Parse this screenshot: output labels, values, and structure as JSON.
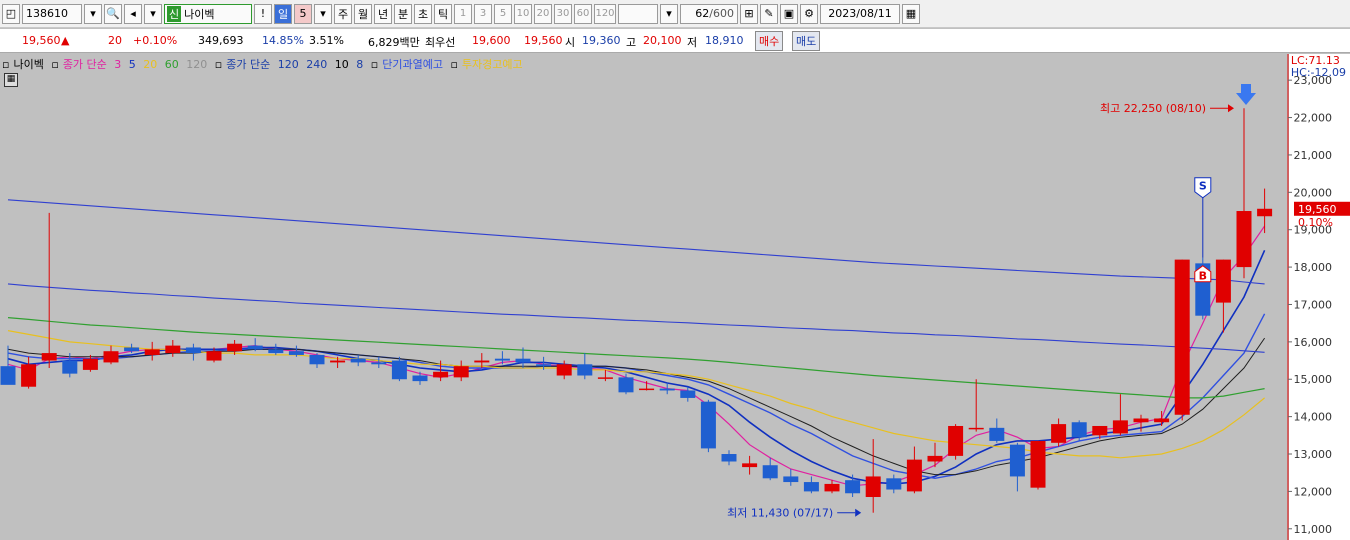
{
  "toolbar": {
    "code": "138610",
    "name_tag": "신",
    "name": "나이벡",
    "exclaim": "!",
    "period_day": "일",
    "period_value": "5",
    "week": "주",
    "month": "월",
    "year": "년",
    "minute": "분",
    "second": "초",
    "tick": "틱",
    "intervals": [
      "1",
      "3",
      "5",
      "10",
      "20",
      "30",
      "60",
      "120"
    ],
    "count": "62",
    "count_max": "/600",
    "date": "2023/08/11"
  },
  "quote": {
    "price": "19,560",
    "arrow": "▲",
    "change": "20",
    "change_pct": "+0.10%",
    "volume": "349,693",
    "turnover_pct": "14.85%",
    "pct2": "3.51%",
    "amount": "6,829백만",
    "best_ask_label": "최우선",
    "best_ask": "19,600",
    "best_bid": "19,560",
    "open_label": "시",
    "open": "19,360",
    "high_label": "고",
    "high": "20,100",
    "low_label": "저",
    "low": "18,910",
    "buy_btn": "매수",
    "sell_btn": "매도"
  },
  "legend": {
    "name": "나이벡",
    "ma_short_label": "종가 단순",
    "ma_3": "3",
    "ma_5": "5",
    "ma_20": "20",
    "ma_60": "60",
    "ma_120_dim": "120",
    "ma_long_label": "종가 단순",
    "ma_120": "120",
    "ma_240": "240",
    "ma_10": "10",
    "ma_8": "8",
    "warn1": "단기과열예고",
    "warn2": "투자경고예고"
  },
  "corner": {
    "lc": "LC:71.13",
    "hc": "HC:-12.09"
  },
  "colors": {
    "up": "#e00000",
    "down": "#1f5fd0",
    "ma3": "#e020a0",
    "ma5": "#1030c0",
    "ma10": "#3050e0",
    "ma8": "#202020",
    "ma20": "#e8c020",
    "ma60": "#30a030",
    "ma120": "#3040d0",
    "ma240": "#3040d0"
  },
  "chart_data": {
    "type": "candlestick",
    "ylim": [
      10700,
      23700
    ],
    "y_ticks": [
      "23,000",
      "22,000",
      "21,000",
      "20,000",
      "19,000",
      "18,000",
      "17,000",
      "16,000",
      "15,000",
      "14,000",
      "13,000",
      "12,000",
      "11,000"
    ],
    "y_tick_values": [
      23000,
      22000,
      21000,
      20000,
      19000,
      18000,
      17000,
      16000,
      15000,
      14000,
      13000,
      12000,
      11000
    ],
    "last_price_label": "19,560",
    "last_pct_label": "0.10%",
    "last_price": 19560,
    "high_annotation": "최고 22,250 (08/10)",
    "low_annotation": "최저 11,430 (07/17)",
    "high_value": 22250,
    "low_value": 11430,
    "high_index": 60,
    "low_index": 42,
    "signal_s_label": "S",
    "signal_s_index": 58,
    "signal_b_label": "B",
    "signal_b_index": 58,
    "candles": [
      {
        "o": 15350,
        "h": 15900,
        "l": 14900,
        "c": 14850
      },
      {
        "o": 14800,
        "h": 15600,
        "l": 14750,
        "c": 15400
      },
      {
        "o": 15500,
        "h": 19450,
        "l": 15300,
        "c": 15700
      },
      {
        "o": 15500,
        "h": 15700,
        "l": 15050,
        "c": 15150
      },
      {
        "o": 15250,
        "h": 15650,
        "l": 15200,
        "c": 15550
      },
      {
        "o": 15450,
        "h": 15900,
        "l": 15400,
        "c": 15750
      },
      {
        "o": 15850,
        "h": 15950,
        "l": 15700,
        "c": 15750
      },
      {
        "o": 15650,
        "h": 16000,
        "l": 15500,
        "c": 15800
      },
      {
        "o": 15700,
        "h": 16050,
        "l": 15600,
        "c": 15900
      },
      {
        "o": 15850,
        "h": 15950,
        "l": 15500,
        "c": 15700
      },
      {
        "o": 15500,
        "h": 15850,
        "l": 15450,
        "c": 15750
      },
      {
        "o": 15750,
        "h": 16050,
        "l": 15650,
        "c": 15950
      },
      {
        "o": 15900,
        "h": 16100,
        "l": 15750,
        "c": 15800
      },
      {
        "o": 15800,
        "h": 15950,
        "l": 15650,
        "c": 15700
      },
      {
        "o": 15750,
        "h": 15900,
        "l": 15600,
        "c": 15650
      },
      {
        "o": 15650,
        "h": 15700,
        "l": 15300,
        "c": 15400
      },
      {
        "o": 15450,
        "h": 15600,
        "l": 15300,
        "c": 15500
      },
      {
        "o": 15550,
        "h": 15650,
        "l": 15350,
        "c": 15450
      },
      {
        "o": 15450,
        "h": 15600,
        "l": 15300,
        "c": 15400
      },
      {
        "o": 15500,
        "h": 15600,
        "l": 14950,
        "c": 15000
      },
      {
        "o": 15100,
        "h": 15200,
        "l": 14850,
        "c": 14950
      },
      {
        "o": 15050,
        "h": 15500,
        "l": 14950,
        "c": 15200
      },
      {
        "o": 15050,
        "h": 15500,
        "l": 14950,
        "c": 15350
      },
      {
        "o": 15450,
        "h": 15700,
        "l": 15300,
        "c": 15500
      },
      {
        "o": 15550,
        "h": 15750,
        "l": 15400,
        "c": 15500
      },
      {
        "o": 15550,
        "h": 15850,
        "l": 15300,
        "c": 15450
      },
      {
        "o": 15400,
        "h": 15600,
        "l": 15250,
        "c": 15350
      },
      {
        "o": 15100,
        "h": 15500,
        "l": 15000,
        "c": 15400
      },
      {
        "o": 15400,
        "h": 15700,
        "l": 15000,
        "c": 15100
      },
      {
        "o": 15050,
        "h": 15250,
        "l": 14950,
        "c": 15050
      },
      {
        "o": 15050,
        "h": 15150,
        "l": 14600,
        "c": 14650
      },
      {
        "o": 14750,
        "h": 14950,
        "l": 14700,
        "c": 14750
      },
      {
        "o": 14750,
        "h": 14900,
        "l": 14600,
        "c": 14700
      },
      {
        "o": 14700,
        "h": 14800,
        "l": 14400,
        "c": 14500
      },
      {
        "o": 14400,
        "h": 14450,
        "l": 13050,
        "c": 13150
      },
      {
        "o": 13000,
        "h": 13100,
        "l": 12700,
        "c": 12800
      },
      {
        "o": 12650,
        "h": 12950,
        "l": 12450,
        "c": 12750
      },
      {
        "o": 12700,
        "h": 12900,
        "l": 12300,
        "c": 12350
      },
      {
        "o": 12400,
        "h": 12600,
        "l": 12150,
        "c": 12250
      },
      {
        "o": 12250,
        "h": 12400,
        "l": 11950,
        "c": 12000
      },
      {
        "o": 12000,
        "h": 12300,
        "l": 11950,
        "c": 12200
      },
      {
        "o": 12300,
        "h": 12450,
        "l": 11850,
        "c": 11950
      },
      {
        "o": 11850,
        "h": 13400,
        "l": 11430,
        "c": 12400
      },
      {
        "o": 12350,
        "h": 12450,
        "l": 11950,
        "c": 12050
      },
      {
        "o": 12000,
        "h": 13200,
        "l": 11950,
        "c": 12850
      },
      {
        "o": 12800,
        "h": 13300,
        "l": 12650,
        "c": 12950
      },
      {
        "o": 12950,
        "h": 13800,
        "l": 12850,
        "c": 13750
      },
      {
        "o": 13700,
        "h": 15000,
        "l": 13600,
        "c": 13700
      },
      {
        "o": 13700,
        "h": 13950,
        "l": 13300,
        "c": 13350
      },
      {
        "o": 13250,
        "h": 13300,
        "l": 12000,
        "c": 12400
      },
      {
        "o": 12100,
        "h": 13350,
        "l": 12050,
        "c": 13350
      },
      {
        "o": 13300,
        "h": 13950,
        "l": 13200,
        "c": 13800
      },
      {
        "o": 13850,
        "h": 13900,
        "l": 13350,
        "c": 13450
      },
      {
        "o": 13500,
        "h": 13750,
        "l": 13400,
        "c": 13750
      },
      {
        "o": 13550,
        "h": 14600,
        "l": 13500,
        "c": 13900
      },
      {
        "o": 13850,
        "h": 14050,
        "l": 13600,
        "c": 13950
      },
      {
        "o": 13850,
        "h": 14150,
        "l": 13750,
        "c": 13950
      },
      {
        "o": 14050,
        "h": 18200,
        "l": 13900,
        "c": 18200
      },
      {
        "o": 18100,
        "h": 18250,
        "l": 16600,
        "c": 16700
      },
      {
        "o": 17050,
        "h": 18200,
        "l": 16250,
        "c": 18200
      },
      {
        "o": 18000,
        "h": 22250,
        "l": 17700,
        "c": 19500
      },
      {
        "o": 19360,
        "h": 20100,
        "l": 18910,
        "c": 19560
      }
    ],
    "series": [
      {
        "key": "ma3",
        "values": [
          15400,
          15250,
          15550,
          15600,
          15550,
          15650,
          15750,
          15800,
          15800,
          15800,
          15800,
          15850,
          15900,
          15800,
          15750,
          15650,
          15550,
          15500,
          15450,
          15300,
          15150,
          15050,
          15150,
          15300,
          15450,
          15500,
          15400,
          15350,
          15300,
          15250,
          15050,
          14900,
          14750,
          14700,
          14300,
          13800,
          13250,
          12900,
          12600,
          12450,
          12300,
          12150,
          12200,
          12250,
          12450,
          12700,
          13150,
          13500,
          13650,
          13450,
          13150,
          13200,
          13500,
          13650,
          13700,
          13850,
          13950,
          15350,
          16500,
          17700,
          18300,
          19100
        ]
      },
      {
        "key": "ma5",
        "values": [
          15550,
          15400,
          15450,
          15500,
          15500,
          15600,
          15650,
          15750,
          15800,
          15800,
          15800,
          15800,
          15850,
          15850,
          15800,
          15750,
          15650,
          15550,
          15500,
          15400,
          15300,
          15250,
          15200,
          15250,
          15350,
          15450,
          15450,
          15400,
          15350,
          15300,
          15200,
          15050,
          14900,
          14800,
          14600,
          14300,
          13850,
          13450,
          13100,
          12800,
          12550,
          12350,
          12250,
          12200,
          12250,
          12400,
          12650,
          13000,
          13250,
          13350,
          13350,
          13400,
          13450,
          13550,
          13600,
          13700,
          13800,
          14600,
          15400,
          16300,
          17200,
          18450
        ]
      },
      {
        "key": "ma10",
        "values": [
          15700,
          15600,
          15550,
          15550,
          15550,
          15550,
          15600,
          15650,
          15700,
          15750,
          15750,
          15800,
          15800,
          15800,
          15800,
          15750,
          15700,
          15650,
          15600,
          15550,
          15450,
          15350,
          15300,
          15300,
          15300,
          15300,
          15350,
          15350,
          15350,
          15350,
          15300,
          15200,
          15100,
          15000,
          14850,
          14600,
          14350,
          14100,
          13800,
          13550,
          13250,
          12950,
          12750,
          12550,
          12450,
          12350,
          12450,
          12600,
          12800,
          12900,
          13050,
          13200,
          13350,
          13450,
          13500,
          13550,
          13600,
          14000,
          14500,
          15100,
          15700,
          16750
        ]
      },
      {
        "key": "ma8",
        "values": [
          15800,
          15700,
          15650,
          15600,
          15600,
          15600,
          15600,
          15650,
          15700,
          15700,
          15750,
          15750,
          15800,
          15800,
          15800,
          15750,
          15700,
          15650,
          15600,
          15550,
          15500,
          15400,
          15350,
          15350,
          15350,
          15350,
          15350,
          15350,
          15350,
          15350,
          15300,
          15250,
          15150,
          15050,
          14950,
          14750,
          14500,
          14250,
          14000,
          13750,
          13450,
          13200,
          12950,
          12750,
          12550,
          12450,
          12450,
          12550,
          12700,
          12800,
          12900,
          13050,
          13200,
          13350,
          13450,
          13500,
          13550,
          13800,
          14200,
          14750,
          15300,
          16100
        ]
      },
      {
        "key": "ma20",
        "values": [
          16300,
          16200,
          16100,
          16000,
          15950,
          15900,
          15850,
          15800,
          15800,
          15750,
          15700,
          15700,
          15650,
          15650,
          15650,
          15600,
          15550,
          15550,
          15500,
          15450,
          15400,
          15400,
          15350,
          15350,
          15300,
          15300,
          15300,
          15300,
          15250,
          15250,
          15200,
          15200,
          15150,
          15100,
          15000,
          14850,
          14700,
          14550,
          14350,
          14200,
          14000,
          13850,
          13700,
          13550,
          13450,
          13350,
          13300,
          13250,
          13200,
          13150,
          13050,
          13000,
          12950,
          12950,
          12900,
          12950,
          13000,
          13150,
          13350,
          13650,
          14050,
          14500
        ]
      },
      {
        "key": "ma60",
        "values": [
          16650,
          16600,
          16550,
          16500,
          16450,
          16420,
          16380,
          16340,
          16300,
          16260,
          16230,
          16200,
          16170,
          16140,
          16110,
          16080,
          16050,
          16020,
          15990,
          15960,
          15930,
          15900,
          15870,
          15840,
          15810,
          15780,
          15750,
          15720,
          15690,
          15660,
          15630,
          15600,
          15570,
          15540,
          15500,
          15450,
          15400,
          15350,
          15300,
          15250,
          15200,
          15150,
          15100,
          15060,
          15020,
          14980,
          14940,
          14900,
          14860,
          14820,
          14780,
          14740,
          14700,
          14660,
          14620,
          14580,
          14540,
          14500,
          14500,
          14550,
          14650,
          14750
        ]
      },
      {
        "key": "ma120",
        "values": [
          17550,
          17500,
          17460,
          17420,
          17380,
          17350,
          17310,
          17280,
          17240,
          17210,
          17170,
          17140,
          17110,
          17080,
          17040,
          17010,
          16980,
          16950,
          16920,
          16890,
          16860,
          16830,
          16800,
          16770,
          16740,
          16720,
          16690,
          16660,
          16640,
          16610,
          16580,
          16560,
          16530,
          16510,
          16480,
          16450,
          16430,
          16400,
          16370,
          16350,
          16320,
          16300,
          16270,
          16240,
          16220,
          16190,
          16170,
          16140,
          16110,
          16080,
          16060,
          16030,
          16000,
          15970,
          15940,
          15920,
          15890,
          15860,
          15830,
          15800,
          15760,
          15720
        ]
      },
      {
        "key": "ma240",
        "values": [
          19800,
          19760,
          19720,
          19680,
          19640,
          19600,
          19560,
          19520,
          19480,
          19440,
          19400,
          19360,
          19320,
          19280,
          19240,
          19200,
          19160,
          19120,
          19080,
          19040,
          19000,
          18960,
          18920,
          18880,
          18840,
          18800,
          18760,
          18720,
          18680,
          18640,
          18600,
          18560,
          18520,
          18480,
          18440,
          18400,
          18360,
          18320,
          18280,
          18240,
          18200,
          18160,
          18120,
          18090,
          18060,
          18030,
          18000,
          17970,
          17940,
          17910,
          17880,
          17850,
          17820,
          17790,
          17760,
          17740,
          17720,
          17700,
          17680,
          17660,
          17600,
          17550
        ]
      }
    ]
  }
}
